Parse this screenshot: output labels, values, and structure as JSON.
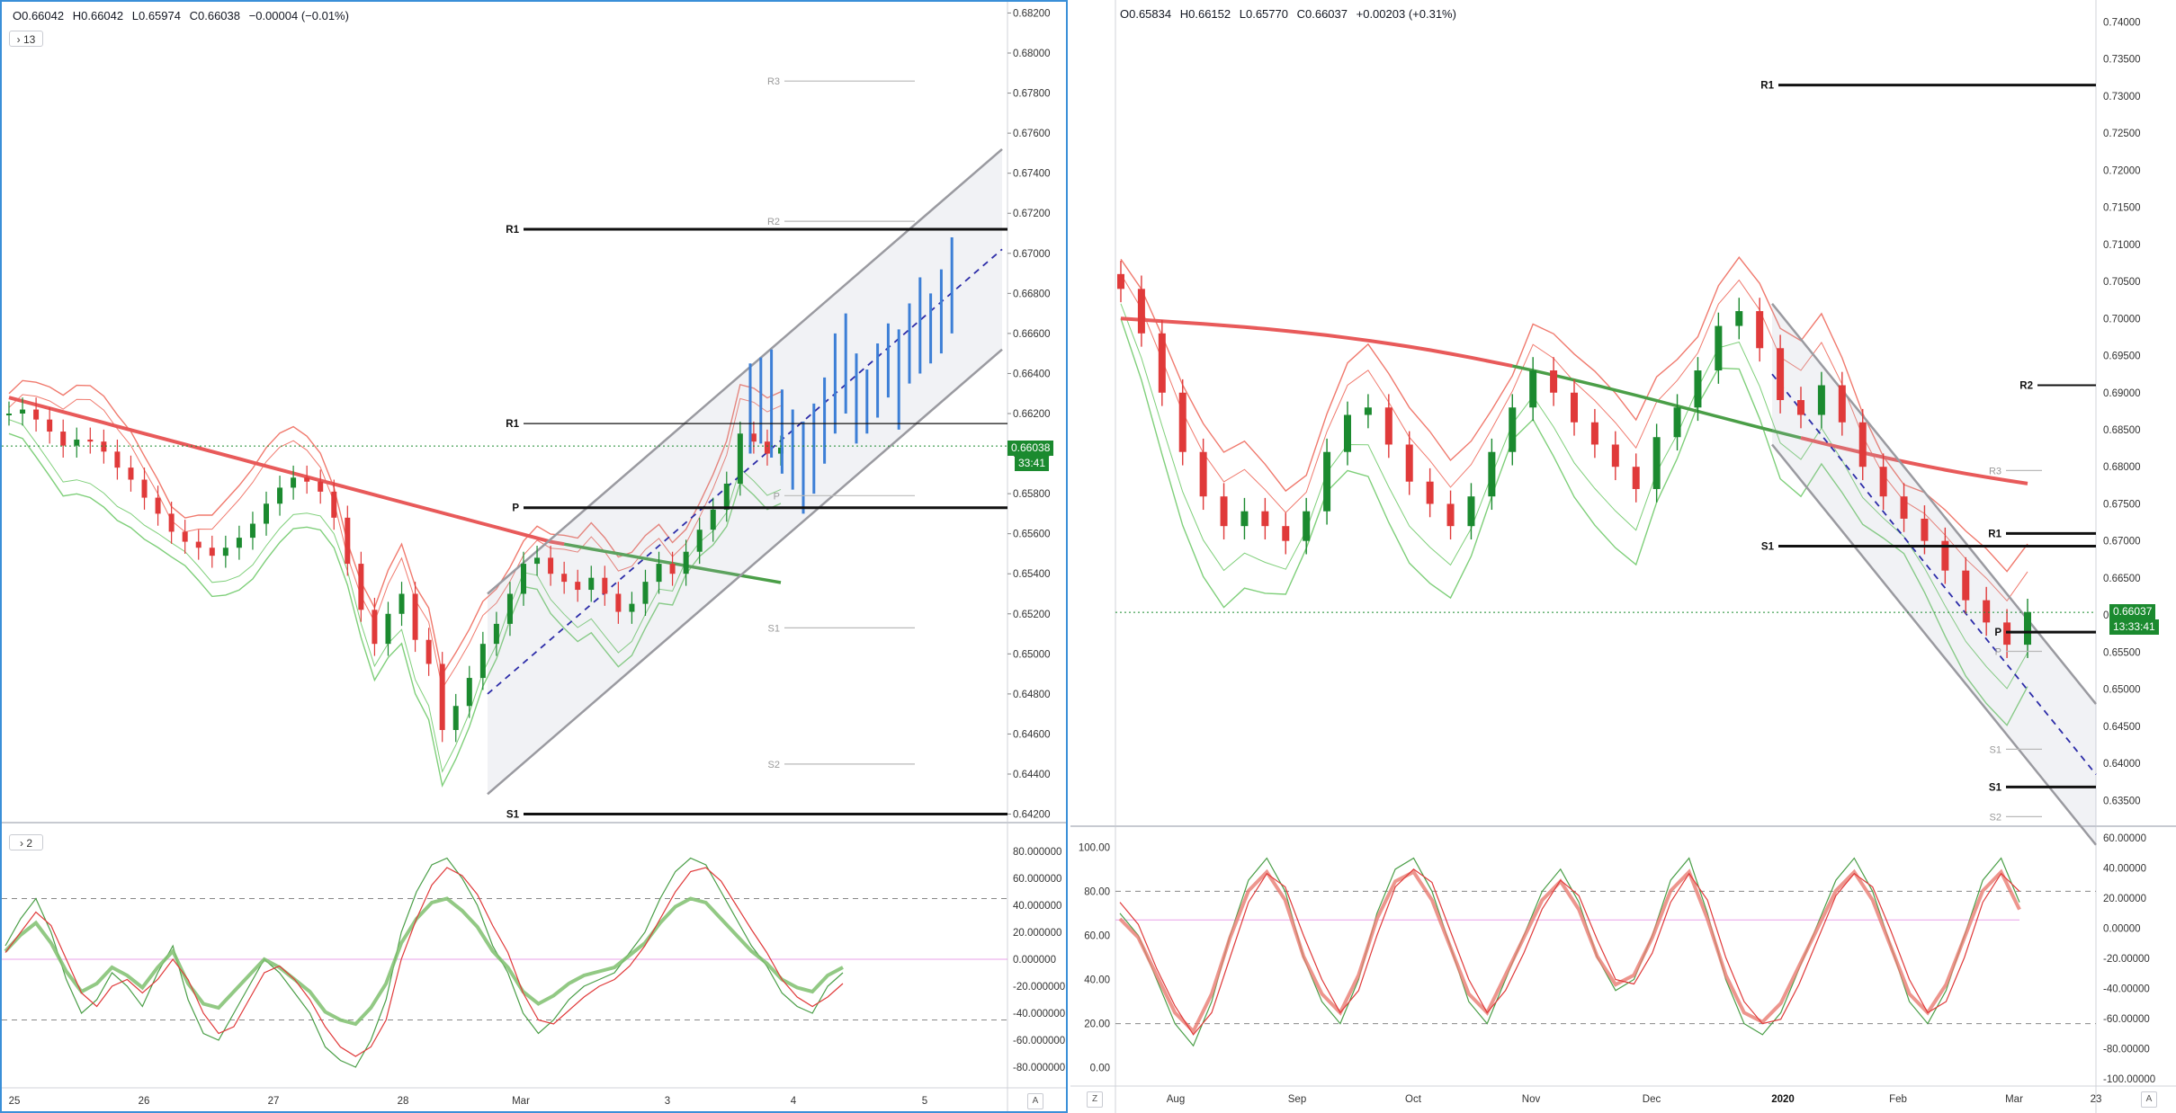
{
  "left": {
    "ohlc": {
      "o": "O0.66042",
      "h": "H0.66042",
      "l": "L0.65974",
      "c": "C0.66038",
      "chg": "−0.00004 (−0.01%)"
    },
    "toggle_main": "13",
    "toggle_osc": "2",
    "price_tag": "0.66038",
    "timer_tag": "33:41",
    "corner_label": "A"
  },
  "right": {
    "ohlc": {
      "o": "O0.65834",
      "h": "H0.66152",
      "l": "L0.65770",
      "c": "C0.66037",
      "chg": "+0.00203 (+0.31%)"
    },
    "price_tag": "0.66037",
    "timer_tag": "13:33:41",
    "corner_left": "Z",
    "corner_right": "A"
  },
  "colors": {
    "bull": "#1b8a2f",
    "bear": "#e03a3a",
    "ma": "#e85a5a",
    "ma_green": "#4a9e47",
    "band_red": "#f07a6e",
    "band_green": "#7fcf7a",
    "channel": "#9a9aa0",
    "blue_bar": "#3d7fd6"
  },
  "chart_data": [
    {
      "type": "line",
      "title": "Intraday price chart (left)",
      "x_ticks": [
        "25",
        "26",
        "27",
        "28",
        "Mar",
        "3",
        "4",
        "5"
      ],
      "y_ticks": [
        "0.68200",
        "0.68000",
        "0.67800",
        "0.67600",
        "0.67400",
        "0.67200",
        "0.67000",
        "0.66800",
        "0.66600",
        "0.66400",
        "0.66200",
        "0.66000",
        "0.65800",
        "0.65600",
        "0.65400",
        "0.65200",
        "0.65000",
        "0.64800",
        "0.64600",
        "0.64400",
        "0.64200"
      ],
      "ylim": [
        0.6418,
        0.6822
      ],
      "pivot_levels": [
        {
          "label": "R1",
          "value": 0.6712,
          "style": "bold"
        },
        {
          "label": "R1",
          "value": 0.6615,
          "style": "thin"
        },
        {
          "label": "P",
          "value": 0.6573,
          "style": "bold"
        },
        {
          "label": "S1",
          "value": 0.642,
          "style": "bold"
        },
        {
          "label": "R3",
          "value": 0.6786,
          "style": "gray"
        },
        {
          "label": "R2",
          "value": 0.6716,
          "style": "gray"
        },
        {
          "label": "P",
          "value": 0.6579,
          "style": "gray"
        },
        {
          "label": "S1",
          "value": 0.6513,
          "style": "gray"
        },
        {
          "label": "S2",
          "value": 0.6445,
          "style": "gray"
        }
      ],
      "close_series": [
        0.662,
        0.6622,
        0.6617,
        0.6611,
        0.6604,
        0.6607,
        0.6606,
        0.6601,
        0.6593,
        0.6587,
        0.6578,
        0.657,
        0.6561,
        0.6556,
        0.6553,
        0.6549,
        0.6553,
        0.6558,
        0.6565,
        0.6575,
        0.6583,
        0.6588,
        0.6586,
        0.6581,
        0.6568,
        0.6545,
        0.6522,
        0.6505,
        0.652,
        0.653,
        0.6507,
        0.6495,
        0.6462,
        0.6474,
        0.6488,
        0.6505,
        0.6515,
        0.653,
        0.6545,
        0.6548,
        0.654,
        0.6536,
        0.6532,
        0.6538,
        0.653,
        0.6521,
        0.6525,
        0.6536,
        0.6545,
        0.654,
        0.6551,
        0.6562,
        0.6572,
        0.6585,
        0.661,
        0.6606,
        0.66,
        0.6603
      ],
      "channel": {
        "upper": [
          0.653,
          0.6752
        ],
        "lower": [
          0.643,
          0.6652
        ],
        "mid": [
          0.648,
          0.6702
        ]
      },
      "blue_bars_hl": [
        [
          0.6645,
          0.66
        ],
        [
          0.6648,
          0.6605
        ],
        [
          0.6652,
          0.6598
        ],
        [
          0.6632,
          0.659
        ],
        [
          0.6622,
          0.6582
        ],
        [
          0.6616,
          0.657
        ],
        [
          0.6625,
          0.658
        ],
        [
          0.6638,
          0.6595
        ],
        [
          0.666,
          0.661
        ],
        [
          0.667,
          0.662
        ],
        [
          0.665,
          0.6605
        ],
        [
          0.6642,
          0.661
        ],
        [
          0.6655,
          0.6618
        ],
        [
          0.6665,
          0.6628
        ],
        [
          0.6662,
          0.6612
        ],
        [
          0.6675,
          0.6635
        ],
        [
          0.6688,
          0.664
        ],
        [
          0.668,
          0.6645
        ],
        [
          0.6692,
          0.665
        ],
        [
          0.6708,
          0.666
        ]
      ]
    },
    {
      "type": "line",
      "title": "Daily price chart (right)",
      "x_ticks": [
        "Aug",
        "Sep",
        "Oct",
        "Nov",
        "Dec",
        "2020",
        "Feb",
        "Mar",
        "23"
      ],
      "y_ticks": [
        "0.74000",
        "0.73500",
        "0.73000",
        "0.72500",
        "0.72000",
        "0.71500",
        "0.71000",
        "0.70500",
        "0.70000",
        "0.69500",
        "0.69000",
        "0.68500",
        "0.68000",
        "0.67500",
        "0.67000",
        "0.66500",
        "0.66000",
        "0.65500",
        "0.65000",
        "0.64500",
        "0.64000",
        "0.63500"
      ],
      "ylim": [
        0.632,
        0.742
      ],
      "pivot_levels": [
        {
          "label": "R1",
          "value": 0.7315,
          "style": "bold"
        },
        {
          "label": "R2",
          "value": 0.691,
          "style": "thin"
        },
        {
          "label": "R3",
          "value": 0.6795,
          "style": "gray"
        },
        {
          "label": "R1",
          "value": 0.671,
          "style": "bold"
        },
        {
          "label": "S1",
          "value": 0.6693,
          "style": "bold"
        },
        {
          "label": "P",
          "value": 0.6577,
          "style": "bold"
        },
        {
          "label": "P",
          "value": 0.6551,
          "style": "gray"
        },
        {
          "label": "S1",
          "value": 0.6419,
          "style": "gray"
        },
        {
          "label": "S1",
          "value": 0.6368,
          "style": "bold"
        },
        {
          "label": "S2",
          "value": 0.6328,
          "style": "gray"
        }
      ],
      "close_series": [
        0.704,
        0.698,
        0.69,
        0.682,
        0.676,
        0.672,
        0.674,
        0.672,
        0.67,
        0.674,
        0.682,
        0.687,
        0.688,
        0.683,
        0.678,
        0.675,
        0.672,
        0.676,
        0.682,
        0.688,
        0.693,
        0.69,
        0.686,
        0.683,
        0.68,
        0.677,
        0.684,
        0.688,
        0.693,
        0.699,
        0.701,
        0.696,
        0.689,
        0.687,
        0.691,
        0.686,
        0.68,
        0.676,
        0.673,
        0.67,
        0.666,
        0.662,
        0.659,
        0.656,
        0.6604
      ],
      "channel": {
        "upper": [
          0.702,
          0.648
        ],
        "lower": [
          0.683,
          0.629
        ],
        "mid": [
          0.6925,
          0.6385
        ]
      }
    },
    {
      "type": "line",
      "title": "Oscillator (left)",
      "y_ticks": [
        "80.000000",
        "60.000000",
        "40.000000",
        "20.000000",
        "0.000000",
        "-20.000000",
        "-40.000000",
        "-60.000000",
        "-80.000000"
      ],
      "ylim": [
        -90,
        90
      ],
      "reference_lines": [
        45,
        0,
        -45
      ],
      "series": [
        {
          "name": "fast",
          "values": [
            10,
            30,
            45,
            20,
            -15,
            -40,
            -30,
            -10,
            -20,
            -35,
            -10,
            10,
            -30,
            -55,
            -60,
            -40,
            -20,
            0,
            -10,
            -25,
            -40,
            -65,
            -75,
            -80,
            -60,
            -30,
            20,
            50,
            70,
            75,
            60,
            40,
            10,
            -10,
            -40,
            -55,
            -45,
            -30,
            -20,
            -15,
            -10,
            5,
            20,
            45,
            65,
            75,
            70,
            50,
            30,
            10,
            -5,
            -25,
            -35,
            -40,
            -20,
            -10
          ]
        },
        {
          "name": "slow",
          "values": [
            5,
            20,
            35,
            25,
            0,
            -25,
            -35,
            -20,
            -15,
            -25,
            -15,
            0,
            -15,
            -40,
            -55,
            -50,
            -30,
            -10,
            -5,
            -15,
            -30,
            -50,
            -65,
            -72,
            -65,
            -45,
            0,
            30,
            55,
            68,
            62,
            48,
            25,
            5,
            -25,
            -45,
            -48,
            -38,
            -28,
            -20,
            -15,
            -5,
            10,
            30,
            50,
            65,
            68,
            58,
            40,
            22,
            5,
            -15,
            -28,
            -35,
            -28,
            -18
          ]
        }
      ]
    },
    {
      "type": "line",
      "title": "Oscillator (right)",
      "y_ticks_left": [
        "100.00",
        "80.00",
        "60.00",
        "40.00",
        "20.00",
        "0.00"
      ],
      "y_ticks_right": [
        "60.00000",
        "40.00000",
        "20.00000",
        "0.00000",
        "-20.00000",
        "-40.00000",
        "-60.00000",
        "-80.00000",
        "-100.00000"
      ],
      "ylim": [
        -5,
        105
      ],
      "reference_lines": [
        80,
        20
      ],
      "series": [
        {
          "name": "fast",
          "values": [
            70,
            60,
            40,
            20,
            10,
            30,
            60,
            85,
            95,
            80,
            50,
            30,
            20,
            40,
            70,
            90,
            95,
            80,
            55,
            30,
            20,
            40,
            60,
            80,
            90,
            75,
            50,
            35,
            40,
            60,
            85,
            95,
            70,
            40,
            20,
            15,
            25,
            45,
            65,
            85,
            95,
            80,
            55,
            30,
            20,
            35,
            60,
            85,
            95,
            75
          ]
        },
        {
          "name": "slow",
          "values": [
            75,
            65,
            45,
            28,
            15,
            25,
            50,
            75,
            88,
            82,
            60,
            40,
            25,
            35,
            60,
            82,
            90,
            84,
            62,
            40,
            25,
            35,
            52,
            72,
            85,
            78,
            58,
            40,
            38,
            52,
            75,
            88,
            76,
            50,
            30,
            20,
            22,
            38,
            58,
            78,
            88,
            82,
            62,
            40,
            25,
            30,
            50,
            75,
            88,
            80
          ]
        }
      ]
    }
  ]
}
